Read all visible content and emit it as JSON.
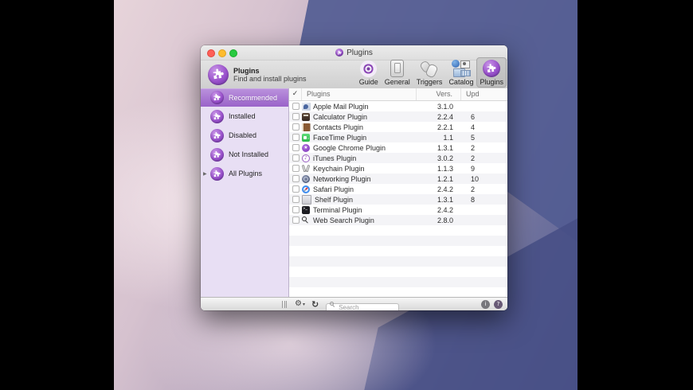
{
  "window": {
    "title": "Plugins"
  },
  "toolbar": {
    "app_section": {
      "title": "Plugins",
      "subtitle": "Find and install plugins"
    },
    "buttons": [
      {
        "label": "Guide"
      },
      {
        "label": "General"
      },
      {
        "label": "Triggers"
      },
      {
        "label": "Catalog"
      },
      {
        "label": "Plugins",
        "selected": true
      }
    ]
  },
  "sidebar": {
    "items": [
      {
        "label": "Recommended",
        "selected": true
      },
      {
        "label": "Installed"
      },
      {
        "label": "Disabled"
      },
      {
        "label": "Not Installed"
      },
      {
        "label": "All Plugins",
        "disclosure": "▶"
      }
    ]
  },
  "table": {
    "columns": {
      "check": "✓",
      "name": "Plugins",
      "version": "Vers.",
      "updated": "Upd"
    },
    "rows": [
      {
        "icon": "apple-mail",
        "name": "Apple Mail Plugin",
        "version": "3.1.0",
        "updated": ""
      },
      {
        "icon": "calculator",
        "name": "Calculator Plugin",
        "version": "2.2.4",
        "updated": "6"
      },
      {
        "icon": "contacts",
        "name": "Contacts Plugin",
        "version": "2.2.1",
        "updated": "4"
      },
      {
        "icon": "facetime",
        "name": "FaceTime Plugin",
        "version": "1.1",
        "updated": "5"
      },
      {
        "icon": "chrome",
        "name": "Google Chrome Plugin",
        "version": "1.3.1",
        "updated": "2"
      },
      {
        "icon": "itunes",
        "name": "iTunes Plugin",
        "version": "3.0.2",
        "updated": "2"
      },
      {
        "icon": "keychain",
        "name": "Keychain Plugin",
        "version": "1.1.3",
        "updated": "9"
      },
      {
        "icon": "networking",
        "name": "Networking Plugin",
        "version": "1.2.1",
        "updated": "10"
      },
      {
        "icon": "safari",
        "name": "Safari Plugin",
        "version": "2.4.2",
        "updated": "2"
      },
      {
        "icon": "shelf",
        "name": "Shelf Plugin",
        "version": "1.3.1",
        "updated": "8"
      },
      {
        "icon": "terminal",
        "name": "Terminal Plugin",
        "version": "2.4.2",
        "updated": ""
      },
      {
        "icon": "web-search",
        "name": "Web Search Plugin",
        "version": "2.8.0",
        "updated": ""
      }
    ]
  },
  "bottombar": {
    "gear": "⚙",
    "caret": "▾",
    "refresh": "↻",
    "search_placeholder": "Search",
    "info": "i",
    "help": "?"
  },
  "colors": {
    "accent_purple": "#8a46b5",
    "sidebar_bg": "#e8dff4",
    "selection_top": "#bb92dd",
    "selection_bottom": "#9a63c9",
    "traffic_red": "#ff5f57",
    "traffic_yellow": "#febc2e",
    "traffic_green": "#28c940"
  }
}
